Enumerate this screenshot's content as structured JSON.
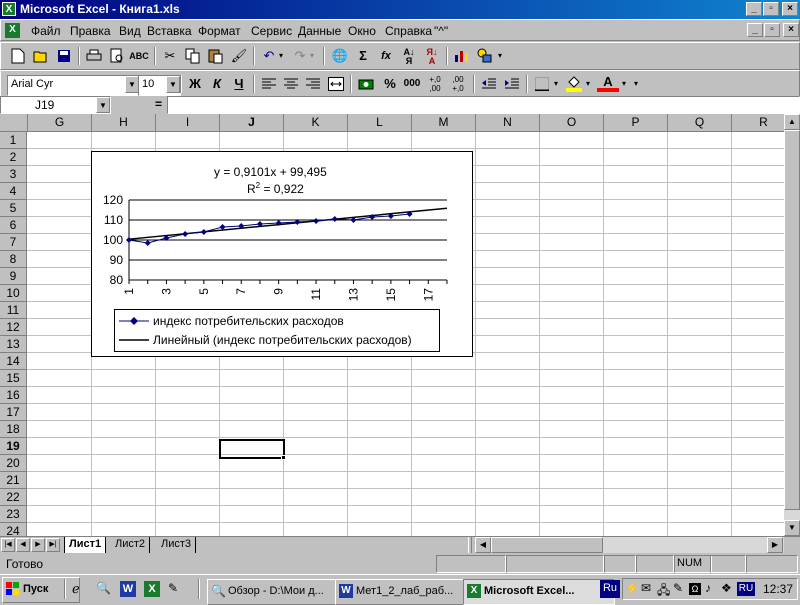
{
  "window": {
    "title": "Microsoft Excel - Книга1.xls",
    "controls": {
      "minimize": "_",
      "maximize": "▫",
      "close": "×"
    }
  },
  "menu": {
    "items": [
      "Файл",
      "Правка",
      "Вид",
      "Вставка",
      "Формат",
      "Сервис",
      "Данные",
      "Окно",
      "Справка",
      "\"^\""
    ],
    "doc_controls": {
      "minimize": "_",
      "restore": "▫",
      "close": "×"
    }
  },
  "standard_toolbar": {
    "icons": [
      "new-icon",
      "open-icon",
      "save-icon",
      "print-icon",
      "print-preview-icon",
      "spelling-icon",
      "cut-icon",
      "copy-icon",
      "paste-icon",
      "format-painter-icon",
      "undo-icon",
      "redo-icon",
      "web-toolbar-icon",
      "autosum-icon",
      "function-icon",
      "sort-ascending-icon",
      "sort-descending-icon",
      "chart-wizard-icon",
      "drawing-icon"
    ],
    "glyphs": {
      "autosum": "Σ",
      "function": "fx"
    }
  },
  "format_toolbar": {
    "font_name": "Arial Cyr",
    "font_size": "10",
    "bold": "Ж",
    "italic": "К",
    "underline": "Ч",
    "percent": "%",
    "thousands": "000",
    "increase_decimal": "+,0\n,00",
    "decrease_decimal": ",00\n+,0"
  },
  "formula_bar": {
    "name_box": "J19",
    "equals": "=",
    "value": ""
  },
  "grid": {
    "columns": [
      "G",
      "H",
      "I",
      "J",
      "K",
      "L",
      "M",
      "N",
      "O",
      "P",
      "Q",
      "R"
    ],
    "rows": [
      "1",
      "2",
      "3",
      "4",
      "5",
      "6",
      "7",
      "8",
      "9",
      "10",
      "11",
      "12",
      "13",
      "14",
      "15",
      "16",
      "17",
      "18",
      "19",
      "20",
      "21",
      "22",
      "23",
      "24"
    ],
    "selected_cell": "J19",
    "selected_column": "J",
    "selected_row": "19"
  },
  "chart_data": {
    "type": "line",
    "equation": "y = 0,9101x + 99,495",
    "r2_label": "R",
    "r2_sup": "2",
    "r2_value": " = 0,922",
    "x": [
      1,
      2,
      3,
      4,
      5,
      6,
      7,
      8,
      9,
      10,
      11,
      12,
      13,
      14,
      15,
      16
    ],
    "x_tick_labels": [
      "1",
      "3",
      "5",
      "7",
      "9",
      "11",
      "13",
      "15",
      "17"
    ],
    "y_ticks": [
      "120",
      "110",
      "100",
      "90",
      "80"
    ],
    "ylim": [
      80,
      120
    ],
    "xlim": [
      1,
      18
    ],
    "series": [
      {
        "name": "индекс потребительских расходов",
        "values": [
          100,
          98.5,
          101,
          103,
          104,
          106.5,
          107,
          108,
          108.5,
          109,
          109.5,
          110.5,
          110,
          111.5,
          112,
          113
        ]
      },
      {
        "name": "Линейный (индекс потребительских расходов)",
        "trend": {
          "slope": 0.9101,
          "intercept": 99.495,
          "x_range": [
            1,
            18
          ]
        }
      }
    ],
    "legend": "bottom",
    "grid": true
  },
  "sheets": {
    "tabs": [
      "Лист1",
      "Лист2",
      "Лист3"
    ],
    "active": "Лист1"
  },
  "status": {
    "ready": "Готово",
    "num": "NUM"
  },
  "taskbar": {
    "start": "Пуск",
    "tasks": [
      "Обзор - D:\\Мои д...",
      "Мет1_2_лаб_раб...",
      "Microsoft Excel..."
    ],
    "active_task": "Microsoft Excel...",
    "lang": "Ru",
    "tray_lang": "RU",
    "time": "12:37"
  }
}
